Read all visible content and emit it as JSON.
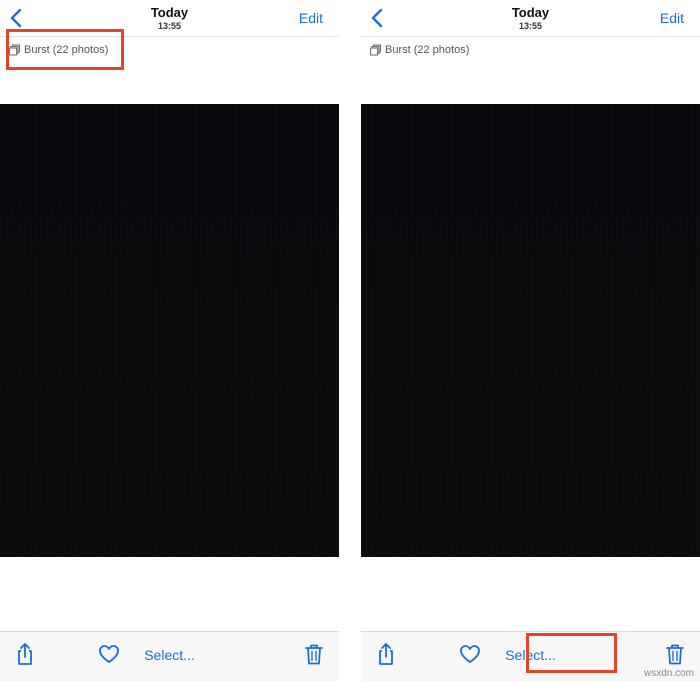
{
  "header": {
    "title": "Today",
    "time": "13:55",
    "edit_label": "Edit"
  },
  "burst": {
    "label": "Burst (22 photos)"
  },
  "toolbar": {
    "select_label": "Select..."
  },
  "icons": {
    "back": "chevron-left-icon",
    "burst": "stack-icon",
    "share": "share-icon",
    "favorite": "heart-icon",
    "delete": "trash-icon"
  },
  "colors": {
    "accent": "#1a6fd6",
    "highlight": "#e2452b",
    "photo": "#0a090c"
  },
  "watermark": "wsxdn.com"
}
